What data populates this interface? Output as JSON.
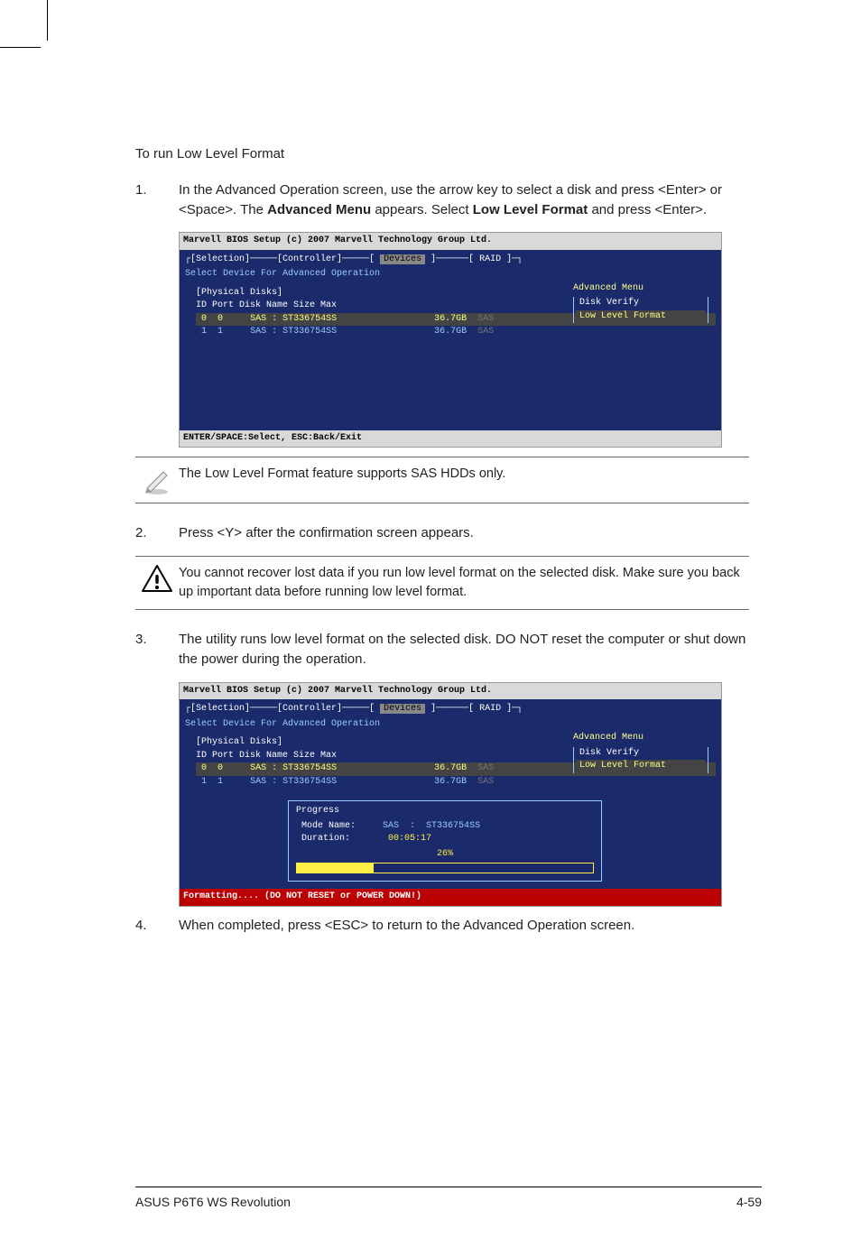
{
  "intro": "To run Low Level Format",
  "step1": {
    "num": "1.",
    "text_a": "In the Advanced Operation screen, use the arrow key to select a disk and press <Enter> or <Space>. The ",
    "bold_a": "Advanced Menu",
    "text_b": " appears. Select ",
    "bold_b": "Low Level Format",
    "text_c": " and press <Enter>."
  },
  "bios_common": {
    "titlebar": "Marvell BIOS Setup (c) 2007 Marvell Technology Group Ltd.",
    "tabs": {
      "a": "[Selection]",
      "b": "[Controller]",
      "c": "Devices",
      "d": "[  RAID  ]"
    },
    "subtitle": "Select Device For Advanced Operation",
    "section": "[Physical Disks]",
    "header": "ID Port  Disk Name                         Size    Max",
    "rows": [
      {
        "id": "0",
        "port": "0",
        "name": "SAS : ST336754SS",
        "size": "36.7GB",
        "max": "SAS",
        "selected": true
      },
      {
        "id": "1",
        "port": "1",
        "name": "SAS : ST336754SS",
        "size": "36.7GB",
        "max": "SAS",
        "selected": false
      }
    ],
    "menu": {
      "title": "Advanced Menu",
      "items": [
        {
          "label": "Disk Verify",
          "selected": false
        },
        {
          "label": "Low Level Format",
          "selected": true
        }
      ]
    },
    "status": "ENTER/SPACE:Select, ESC:Back/Exit"
  },
  "note1": "The Low Level Format feature supports SAS HDDs only.",
  "step2": {
    "num": "2.",
    "text": "Press <Y> after the confirmation screen appears."
  },
  "note2": "You cannot recover lost data if you run low level format on the selected disk. Make sure you back up important data before running low level format.",
  "step3": {
    "num": "3.",
    "text": "The utility runs low level format on the selected disk. DO NOT reset the computer or shut down the power during the operation."
  },
  "bios2": {
    "progress_label": "Progress",
    "mode_label": "Mode Name:",
    "mode_value": "SAS  :  ST336754SS",
    "dur_label": "Duration:",
    "dur_value": "00:05:17",
    "percent": "26%",
    "status": "Formatting.... (DO NOT RESET or POWER DOWN!)"
  },
  "step4": {
    "num": "4.",
    "text": "When completed, press <ESC> to return to the Advanced Operation screen."
  },
  "footer": {
    "left": "ASUS P6T6 WS Revolution",
    "right": "4-59"
  }
}
